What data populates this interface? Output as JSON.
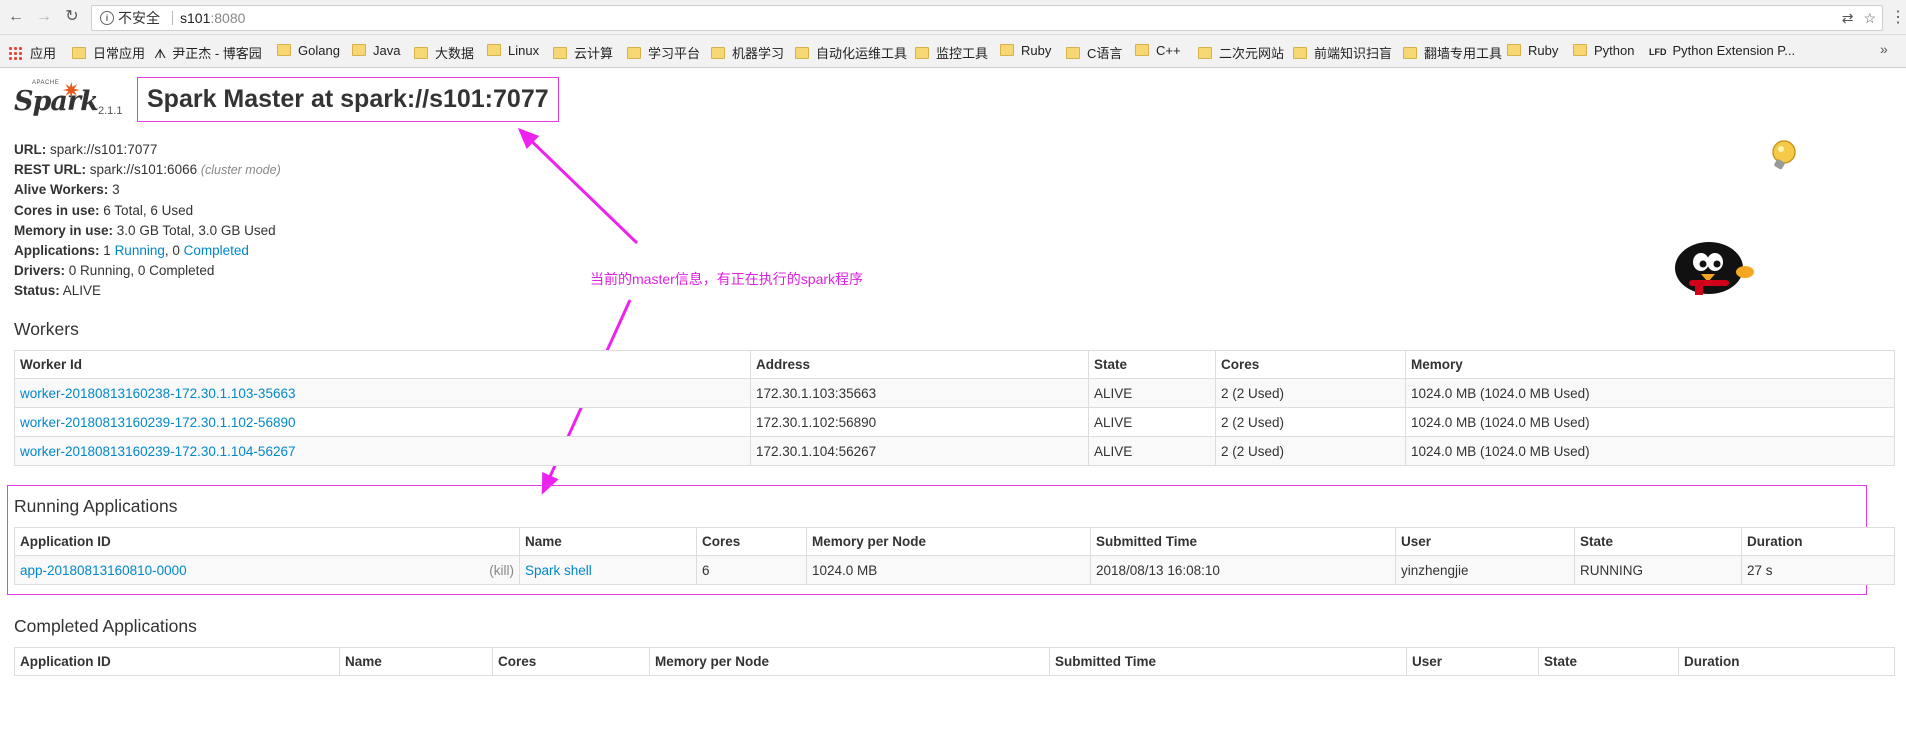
{
  "browser": {
    "insecure_label": "不安全",
    "url_host": "s101",
    "url_port": ":8080",
    "bookmarks": [
      {
        "label": "应用",
        "icon": "apps-grid-icon"
      },
      {
        "label": "日常应用",
        "icon": "folder-icon"
      },
      {
        "label": "尹正杰 - 博客园",
        "icon": "blog-icon"
      },
      {
        "label": "Golang",
        "icon": "folder-icon"
      },
      {
        "label": "Java",
        "icon": "folder-icon"
      },
      {
        "label": "大数据",
        "icon": "folder-icon"
      },
      {
        "label": "Linux",
        "icon": "folder-icon"
      },
      {
        "label": "云计算",
        "icon": "folder-icon"
      },
      {
        "label": "学习平台",
        "icon": "folder-icon"
      },
      {
        "label": "机器学习",
        "icon": "folder-icon"
      },
      {
        "label": "自动化运维工具",
        "icon": "folder-icon"
      },
      {
        "label": "监控工具",
        "icon": "folder-icon"
      },
      {
        "label": "Ruby",
        "icon": "folder-icon"
      },
      {
        "label": "C语言",
        "icon": "folder-icon"
      },
      {
        "label": "C++",
        "icon": "folder-icon"
      },
      {
        "label": "二次元网站",
        "icon": "folder-icon"
      },
      {
        "label": "前端知识扫盲",
        "icon": "folder-icon"
      },
      {
        "label": "翻墙专用工具",
        "icon": "folder-icon"
      },
      {
        "label": "Ruby",
        "icon": "folder-icon"
      },
      {
        "label": "Python",
        "icon": "folder-icon"
      },
      {
        "label": "Python Extension P...",
        "icon": "lfd-icon"
      }
    ],
    "more_label": "»"
  },
  "header": {
    "logo_apache": "APACHE",
    "logo_word": "Spark",
    "version": "2.1.1",
    "title": "Spark Master at spark://s101:7077"
  },
  "info": {
    "url_label": "URL:",
    "url_value": "spark://s101:7077",
    "rest_label": "REST URL:",
    "rest_value": "spark://s101:6066",
    "rest_mode": "(cluster mode)",
    "alive_label": "Alive Workers:",
    "alive_value": "3",
    "cores_label": "Cores in use:",
    "cores_value": "6 Total, 6 Used",
    "memory_label": "Memory in use:",
    "memory_value": "3.0 GB Total, 3.0 GB Used",
    "apps_label": "Applications:",
    "apps_running_count": "1",
    "apps_running_link": "Running",
    "apps_completed_count": "0",
    "apps_completed_link": "Completed",
    "drivers_label": "Drivers:",
    "drivers_value": "0 Running, 0 Completed",
    "status_label": "Status:",
    "status_value": "ALIVE"
  },
  "annotation": {
    "text": "当前的master信息，有正在执行的spark程序",
    "color": "#e020e0"
  },
  "workers": {
    "heading": "Workers",
    "columns": [
      "Worker Id",
      "Address",
      "State",
      "Cores",
      "Memory"
    ],
    "rows": [
      [
        "worker-20180813160238-172.30.1.103-35663",
        "172.30.1.103:35663",
        "ALIVE",
        "2 (2 Used)",
        "1024.0 MB (1024.0 MB Used)"
      ],
      [
        "worker-20180813160239-172.30.1.102-56890",
        "172.30.1.102:56890",
        "ALIVE",
        "2 (2 Used)",
        "1024.0 MB (1024.0 MB Used)"
      ],
      [
        "worker-20180813160239-172.30.1.104-56267",
        "172.30.1.104:56267",
        "ALIVE",
        "2 (2 Used)",
        "1024.0 MB (1024.0 MB Used)"
      ]
    ]
  },
  "running": {
    "heading": "Running Applications",
    "columns": [
      "Application ID",
      "Name",
      "Cores",
      "Memory per Node",
      "Submitted Time",
      "User",
      "State",
      "Duration"
    ],
    "rows": [
      {
        "id": "app-20180813160810-0000",
        "kill": "(kill)",
        "name": "Spark shell",
        "cores": "6",
        "memory": "1024.0 MB",
        "submitted": "2018/08/13 16:08:10",
        "user": "yinzhengjie",
        "state": "RUNNING",
        "duration": "27 s"
      }
    ]
  },
  "completed": {
    "heading": "Completed Applications",
    "columns": [
      "Application ID",
      "Name",
      "Cores",
      "Memory per Node",
      "Submitted Time",
      "User",
      "State",
      "Duration"
    ]
  }
}
